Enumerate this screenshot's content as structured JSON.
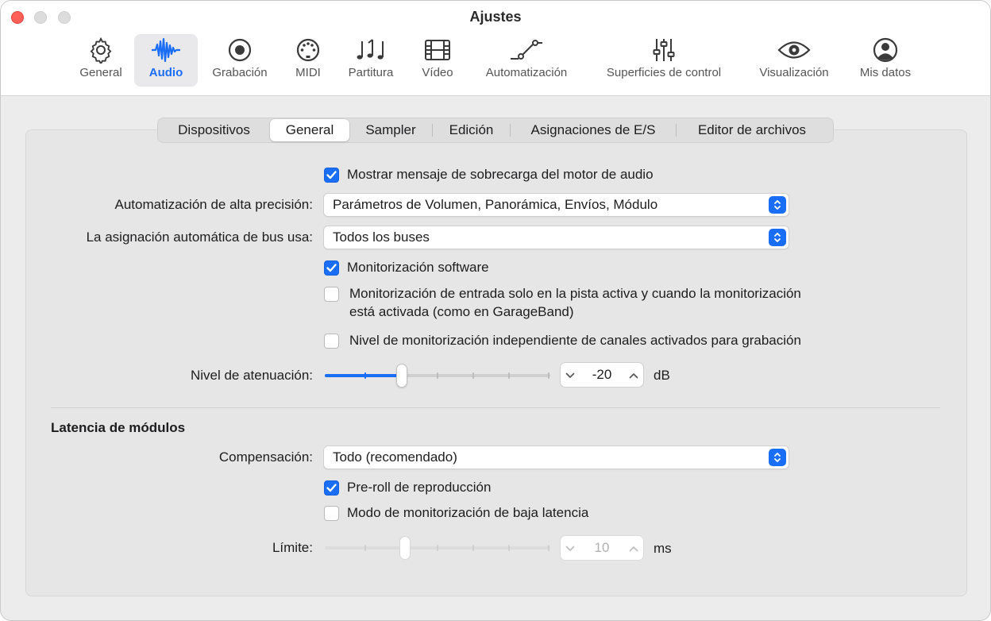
{
  "window": {
    "title": "Ajustes"
  },
  "toolbar": {
    "items": [
      {
        "label": "General",
        "icon": "gear-icon",
        "selected": false
      },
      {
        "label": "Audio",
        "icon": "waveform-icon",
        "selected": true
      },
      {
        "label": "Grabación",
        "icon": "record-icon",
        "selected": false
      },
      {
        "label": "MIDI",
        "icon": "midi-port-icon",
        "selected": false
      },
      {
        "label": "Partitura",
        "icon": "music-notes-icon",
        "selected": false
      },
      {
        "label": "Vídeo",
        "icon": "film-icon",
        "selected": false
      },
      {
        "label": "Automatización",
        "icon": "automation-curve-icon",
        "selected": false
      },
      {
        "label": "Superficies de control",
        "icon": "sliders-icon",
        "selected": false
      },
      {
        "label": "Visualización",
        "icon": "eye-icon",
        "selected": false
      },
      {
        "label": "Mis datos",
        "icon": "person-icon",
        "selected": false
      }
    ]
  },
  "tabs": [
    {
      "label": "Dispositivos",
      "selected": false
    },
    {
      "label": "General",
      "selected": true
    },
    {
      "label": "Sampler",
      "selected": false
    },
    {
      "label": "Edición",
      "selected": false
    },
    {
      "label": "Asignaciones de E/S",
      "selected": false
    },
    {
      "label": "Editor de archivos",
      "selected": false
    }
  ],
  "general": {
    "overload_msg": {
      "label": "Mostrar mensaje de sobrecarga del motor de audio",
      "checked": true
    },
    "high_precision": {
      "label": "Automatización de alta precisión:",
      "value": "Parámetros de Volumen, Panorámica, Envíos, Módulo"
    },
    "auto_bus": {
      "label": "La asignación automática de bus usa:",
      "value": "Todos los buses"
    },
    "software_monitoring": {
      "label": "Monitorización software",
      "checked": true
    },
    "input_monitoring": {
      "line1": "Monitorización de entrada solo en la pista activa y cuando la monitorización",
      "line2": "está activada (como en GarageBand)",
      "checked": false
    },
    "independent_level": {
      "label": "Nivel de monitorización independiente de canales activados para grabación",
      "checked": false
    },
    "dim_level": {
      "label": "Nivel de atenuación:",
      "value": "-20",
      "unit": "dB",
      "fraction": 0.32
    }
  },
  "latency": {
    "title": "Latencia de módulos",
    "compensation": {
      "label": "Compensación:",
      "value": "Todo (recomendado)"
    },
    "preroll": {
      "label": "Pre-roll de reproducción",
      "checked": true
    },
    "low_latency": {
      "label": "Modo de monitorización de baja latencia",
      "checked": false
    },
    "limit": {
      "label": "Límite:",
      "value": "10",
      "unit": "ms",
      "fraction": 0.35
    }
  },
  "colors": {
    "accent": "#1a6ef5",
    "close": "#fe5f57"
  }
}
